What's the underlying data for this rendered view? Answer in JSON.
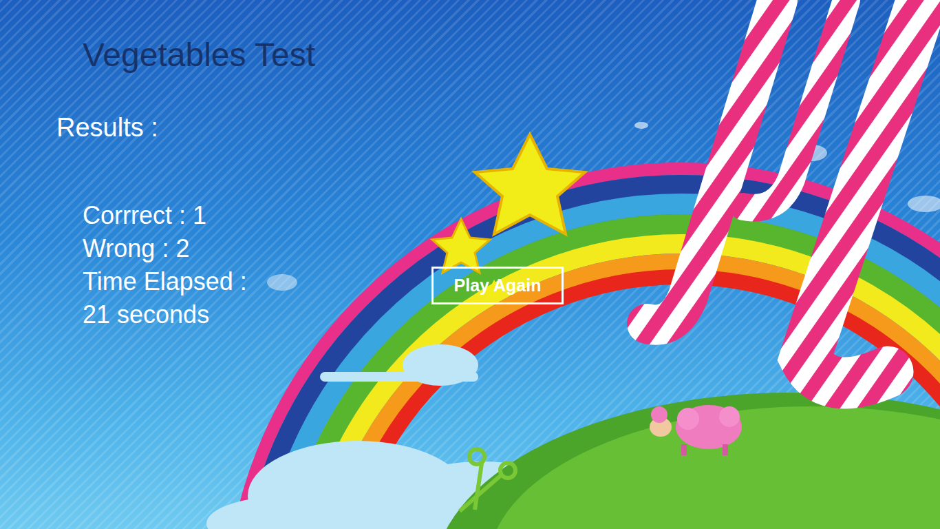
{
  "app": {
    "title": "Vegetables Test"
  },
  "results": {
    "heading": "Results :",
    "lines": [
      "Corrrect : 1",
      "Wrong : 2",
      "Time Elapsed :",
      "21 seconds"
    ]
  },
  "buttons": [
    {
      "label": "Play Again"
    }
  ]
}
